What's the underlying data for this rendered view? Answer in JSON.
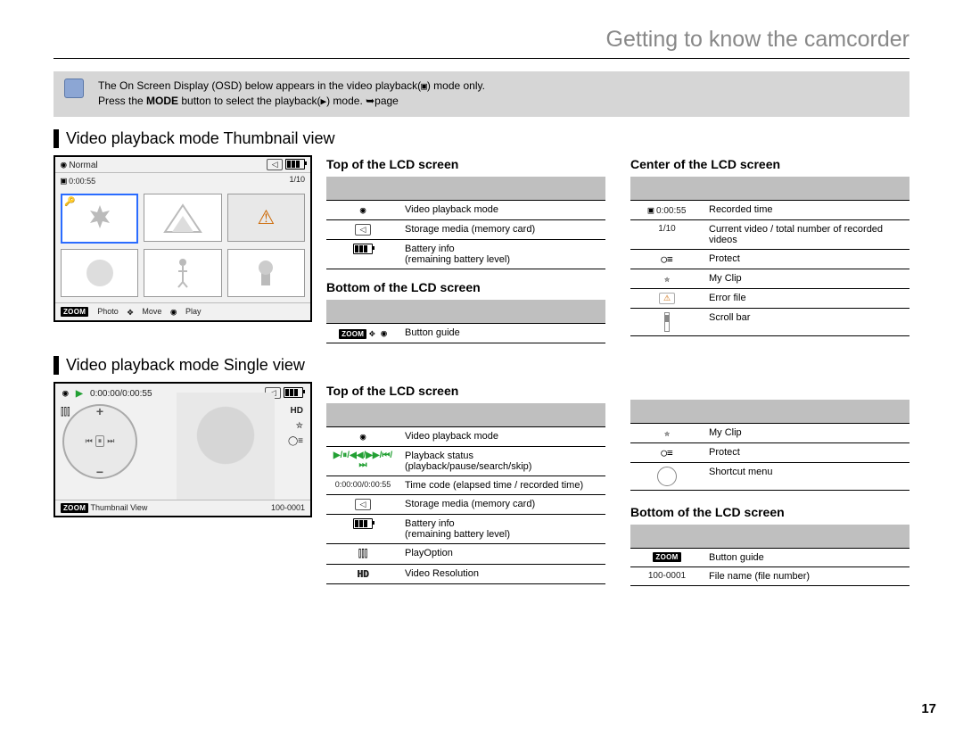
{
  "header": {
    "title": "Getting to know the camcorder"
  },
  "note": {
    "line1a": "The On Screen Display (OSD) below appears in the video playback(",
    "line1b": ") mode only.",
    "line2a": "Press the ",
    "line2b_bold": "MODE",
    "line2c": " button to select the playback(",
    "line2d": ") mode. ➥page"
  },
  "section1": {
    "title": "Video playback mode  Thumbnail view"
  },
  "lcd_thumb": {
    "normal": "Normal",
    "recorded": "0:00:55",
    "counter": "1/10",
    "zoom": "ZOOM",
    "photo": "Photo",
    "move": "Move",
    "play": "Play"
  },
  "table_top1": {
    "head": "Top of the LCD screen",
    "rows": [
      {
        "icon": "film-icon",
        "label": "Video playback mode"
      },
      {
        "icon": "card-icon",
        "label": "Storage media (memory card)"
      },
      {
        "icon": "battery-icon",
        "label": "Battery info\n(remaining battery level)"
      }
    ]
  },
  "table_bottom1": {
    "head": "Bottom of the LCD screen",
    "rows": [
      {
        "icon": "zoom-move-play",
        "label": "Button guide"
      }
    ]
  },
  "table_center": {
    "head": "Center of the LCD screen",
    "rows": [
      {
        "icon": "0:00:55",
        "icon_type": "text",
        "label": "Recorded time"
      },
      {
        "icon": "1/10",
        "icon_type": "text",
        "label": "Current video / total number of recorded videos"
      },
      {
        "icon": "key-icon",
        "label": "Protect"
      },
      {
        "icon": "star-icon",
        "label": "My Clip"
      },
      {
        "icon": "warn-icon",
        "label": "Error file"
      },
      {
        "icon": "scroll-icon",
        "label": "Scroll bar"
      }
    ]
  },
  "section2": {
    "title": "Video playback mode  Single view"
  },
  "lcd_single": {
    "time": "0:00:00/0:00:55",
    "zoom": "ZOOM",
    "thumbview": "Thumbnail View",
    "filenum": "100-0001",
    "hd": "HD"
  },
  "table_top2": {
    "head": "Top of the LCD screen",
    "rows": [
      {
        "icon": "film-icon",
        "label": "Video playback mode"
      },
      {
        "icon": "play-ctrl-icons",
        "label": "Playback status (playback/pause/search/skip)"
      },
      {
        "icon": "0:00:00/0:00:55",
        "icon_type": "text",
        "label": "Time code (elapsed time / recorded time)"
      },
      {
        "icon": "card-icon",
        "label": "Storage media (memory card)"
      },
      {
        "icon": "battery-icon",
        "label": "Battery info\n(remaining battery level)"
      },
      {
        "icon": "playopt-icon",
        "label": "PlayOption"
      },
      {
        "icon": "HD",
        "icon_type": "double-text",
        "label": "Video Resolution"
      }
    ]
  },
  "table_top2_right": {
    "rows": [
      {
        "icon": "star-icon",
        "label": "My Clip"
      },
      {
        "icon": "key-icon",
        "label": "Protect"
      },
      {
        "icon": "dial-icon",
        "label": "Shortcut menu"
      }
    ]
  },
  "table_bottom2": {
    "head": "Bottom of the LCD screen",
    "rows": [
      {
        "icon": "zoom-label",
        "label": "Button guide"
      },
      {
        "icon": "100-0001",
        "icon_type": "text",
        "label": "File name (file number)"
      }
    ]
  },
  "page_number": "17"
}
